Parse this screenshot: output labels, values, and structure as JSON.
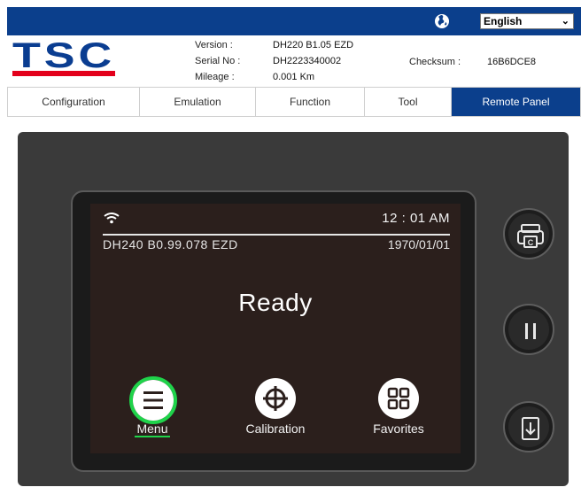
{
  "topbar": {
    "globe_icon": "globe-icon",
    "language": {
      "selected": "English",
      "chevron_icon": "chevron-down-icon"
    }
  },
  "info": {
    "logo_text": "TSC",
    "version_label": "Version :",
    "version_value": "DH220 B1.05 EZD",
    "serial_label": "Serial No :",
    "serial_value": "DH2223340002",
    "mileage_label": "Mileage :",
    "mileage_value": "0.001 Km",
    "checksum_label": "Checksum :",
    "checksum_value": "16B6DCE8"
  },
  "tabs": [
    {
      "label": "Configuration",
      "active": false
    },
    {
      "label": "Emulation",
      "active": false
    },
    {
      "label": "Function",
      "active": false
    },
    {
      "label": "Tool",
      "active": false
    },
    {
      "label": "Remote Panel",
      "active": true
    }
  ],
  "screen": {
    "wifi_icon": "wifi-icon",
    "time": "12 : 01 AM",
    "firmware": "DH240  B0.99.078  EZD",
    "date": "1970/01/01",
    "status": "Ready",
    "buttons": [
      {
        "label": "Menu",
        "icon": "menu-icon",
        "selected": true
      },
      {
        "label": "Calibration",
        "icon": "crosshair-icon",
        "selected": false
      },
      {
        "label": "Favorites",
        "icon": "grid-icon",
        "selected": false
      }
    ]
  },
  "side_buttons": [
    {
      "icon": "print-copy-icon"
    },
    {
      "icon": "pause-icon"
    },
    {
      "icon": "feed-icon"
    }
  ],
  "colors": {
    "brand_blue": "#0b3f8c",
    "logo_blue": "#0a3d91",
    "logo_red": "#e3001b",
    "selection_green": "#1fd34a",
    "screen_bg": "#2b1f1c",
    "panel_bg": "#3a3a3a"
  }
}
